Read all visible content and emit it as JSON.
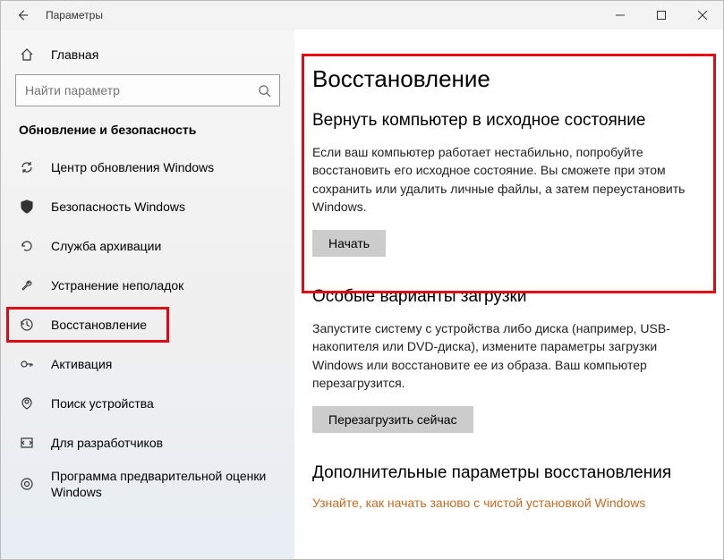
{
  "titlebar": {
    "title": "Параметры"
  },
  "sidebar": {
    "home_label": "Главная",
    "search_placeholder": "Найти параметр",
    "section_title": "Обновление и безопасность",
    "items": [
      {
        "label": "Центр обновления Windows"
      },
      {
        "label": "Безопасность Windows"
      },
      {
        "label": "Служба архивации"
      },
      {
        "label": "Устранение неполадок"
      },
      {
        "label": "Восстановление"
      },
      {
        "label": "Активация"
      },
      {
        "label": "Поиск устройства"
      },
      {
        "label": "Для разработчиков"
      },
      {
        "label": "Программа предварительной оценки Windows"
      }
    ]
  },
  "content": {
    "page_title": "Восстановление",
    "reset": {
      "title": "Вернуть компьютер в исходное состояние",
      "desc": "Если ваш компьютер работает нестабильно, попробуйте восстановить его исходное состояние. Вы сможете при этом сохранить или удалить личные файлы, а затем переустановить Windows.",
      "button": "Начать"
    },
    "advanced_startup": {
      "title": "Особые варианты загрузки",
      "desc": "Запустите систему с устройства либо диска (например, USB-накопителя или DVD-диска), измените параметры загрузки Windows или восстановите ее из образа. Ваш компьютер перезагрузится.",
      "button": "Перезагрузить сейчас"
    },
    "more_options": {
      "title": "Дополнительные параметры восстановления",
      "link": "Узнайте, как начать заново с чистой установкой Windows"
    }
  }
}
